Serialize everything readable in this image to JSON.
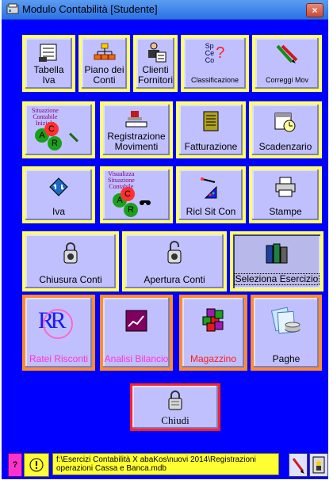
{
  "window": {
    "title": "Modulo Contabilità  [Studente]",
    "close_label": "×"
  },
  "row1": [
    {
      "label": "Tabella\nIva",
      "icon": "ledger-icon"
    },
    {
      "label": "Piano dei\nConti",
      "icon": "org-chart-icon"
    },
    {
      "label": "Clienti\nFornitori",
      "icon": "customer-icon"
    },
    {
      "label": "Classificazione",
      "icon_text": "Sp\nCe\nCo",
      "icon_mark": "?"
    },
    {
      "label": "Correggi Mov",
      "icon": "pencils-icon"
    }
  ],
  "row2": [
    {
      "label": "",
      "icon_text": "Situazione\nContabile\nIniziale",
      "balls": [
        "A",
        "C",
        "R"
      ]
    },
    {
      "label": "Registrazione\nMovimenti",
      "icon": "stamp-icon"
    },
    {
      "label": "Fatturazione",
      "icon": "invoice-icon"
    },
    {
      "label": "Scadenzario",
      "icon": "calendar-clock-icon"
    }
  ],
  "row3": [
    {
      "label": "Iva",
      "icon": "exchange-icon"
    },
    {
      "label": "",
      "icon_text": "Visualizza\nSituazione\nContabile",
      "balls": [
        "A",
        "C",
        "R"
      ]
    },
    {
      "label": "Ricl Sit Con",
      "icon": "chart-icon"
    },
    {
      "label": "Stampe",
      "icon": "printer-icon"
    }
  ],
  "row4": [
    {
      "label": "Chiusura Conti",
      "icon": "padlock-icon"
    },
    {
      "label": "Apertura Conti",
      "icon": "padlock-open-icon"
    },
    {
      "label": "Seleziona Esercizio",
      "icon": "binders-icon"
    }
  ],
  "row5": [
    {
      "label": "Ratei Risconti",
      "icon_text": "R R"
    },
    {
      "label": "Analisi Bilancio",
      "icon": "trend-icon"
    },
    {
      "label": "Magazzino",
      "icon": "cubes-icon"
    },
    {
      "label": "Paghe",
      "icon": "payroll-icon"
    }
  ],
  "close_button": {
    "label": "Chiudi"
  },
  "status": {
    "help_label": "?",
    "path": "f:\\Esercizi Contabilità X abaKos\\nuovi 2014\\Registrazioni operazioni Cassa e Banca.mdb"
  }
}
